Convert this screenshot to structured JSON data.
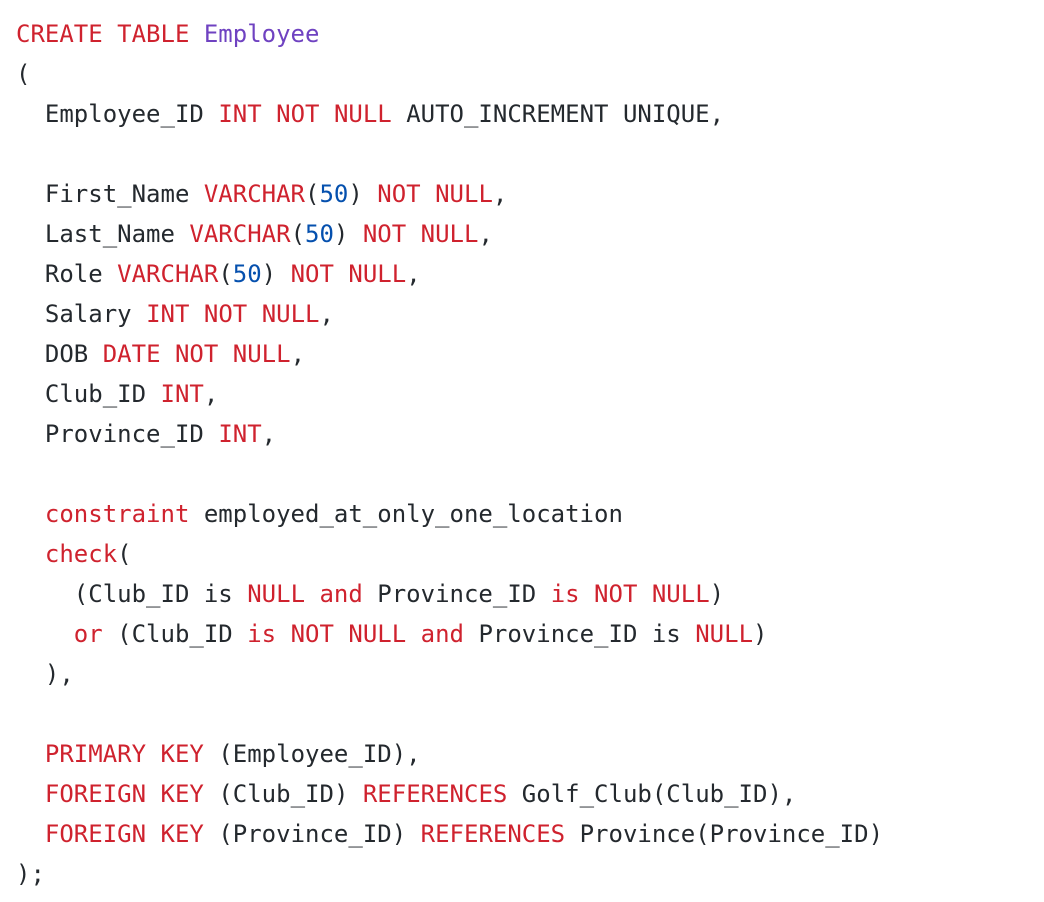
{
  "editor": {
    "language": "sql",
    "colors": {
      "background": "#ffffff",
      "keyword": "#cf222e",
      "identifier": "#24292e",
      "number": "#0550ae",
      "type_name": "#6f42c1"
    },
    "lines": [
      [
        {
          "t": "keyword",
          "v": "CREATE"
        },
        {
          "t": "space",
          "v": " "
        },
        {
          "t": "keyword",
          "v": "TABLE"
        },
        {
          "t": "space",
          "v": " "
        },
        {
          "t": "type",
          "v": "Employee"
        }
      ],
      [
        {
          "t": "punct",
          "v": "("
        }
      ],
      [
        {
          "t": "space",
          "v": "  "
        },
        {
          "t": "ident",
          "v": "Employee_ID"
        },
        {
          "t": "space",
          "v": " "
        },
        {
          "t": "keyword",
          "v": "INT"
        },
        {
          "t": "space",
          "v": " "
        },
        {
          "t": "keyword",
          "v": "NOT"
        },
        {
          "t": "space",
          "v": " "
        },
        {
          "t": "keyword",
          "v": "NULL"
        },
        {
          "t": "space",
          "v": " "
        },
        {
          "t": "ident",
          "v": "AUTO_INCREMENT"
        },
        {
          "t": "space",
          "v": " "
        },
        {
          "t": "ident",
          "v": "UNIQUE"
        },
        {
          "t": "punct",
          "v": ","
        }
      ],
      [],
      [
        {
          "t": "space",
          "v": "  "
        },
        {
          "t": "ident",
          "v": "First_Name"
        },
        {
          "t": "space",
          "v": " "
        },
        {
          "t": "keyword",
          "v": "VARCHAR"
        },
        {
          "t": "punct",
          "v": "("
        },
        {
          "t": "number",
          "v": "50"
        },
        {
          "t": "punct",
          "v": ")"
        },
        {
          "t": "space",
          "v": " "
        },
        {
          "t": "keyword",
          "v": "NOT"
        },
        {
          "t": "space",
          "v": " "
        },
        {
          "t": "keyword",
          "v": "NULL"
        },
        {
          "t": "punct",
          "v": ","
        }
      ],
      [
        {
          "t": "space",
          "v": "  "
        },
        {
          "t": "ident",
          "v": "Last_Name"
        },
        {
          "t": "space",
          "v": " "
        },
        {
          "t": "keyword",
          "v": "VARCHAR"
        },
        {
          "t": "punct",
          "v": "("
        },
        {
          "t": "number",
          "v": "50"
        },
        {
          "t": "punct",
          "v": ")"
        },
        {
          "t": "space",
          "v": " "
        },
        {
          "t": "keyword",
          "v": "NOT"
        },
        {
          "t": "space",
          "v": " "
        },
        {
          "t": "keyword",
          "v": "NULL"
        },
        {
          "t": "punct",
          "v": ","
        }
      ],
      [
        {
          "t": "space",
          "v": "  "
        },
        {
          "t": "ident",
          "v": "Role"
        },
        {
          "t": "space",
          "v": " "
        },
        {
          "t": "keyword",
          "v": "VARCHAR"
        },
        {
          "t": "punct",
          "v": "("
        },
        {
          "t": "number",
          "v": "50"
        },
        {
          "t": "punct",
          "v": ")"
        },
        {
          "t": "space",
          "v": " "
        },
        {
          "t": "keyword",
          "v": "NOT"
        },
        {
          "t": "space",
          "v": " "
        },
        {
          "t": "keyword",
          "v": "NULL"
        },
        {
          "t": "punct",
          "v": ","
        }
      ],
      [
        {
          "t": "space",
          "v": "  "
        },
        {
          "t": "ident",
          "v": "Salary"
        },
        {
          "t": "space",
          "v": " "
        },
        {
          "t": "keyword",
          "v": "INT"
        },
        {
          "t": "space",
          "v": " "
        },
        {
          "t": "keyword",
          "v": "NOT"
        },
        {
          "t": "space",
          "v": " "
        },
        {
          "t": "keyword",
          "v": "NULL"
        },
        {
          "t": "punct",
          "v": ","
        }
      ],
      [
        {
          "t": "space",
          "v": "  "
        },
        {
          "t": "ident",
          "v": "DOB"
        },
        {
          "t": "space",
          "v": " "
        },
        {
          "t": "keyword",
          "v": "DATE"
        },
        {
          "t": "space",
          "v": " "
        },
        {
          "t": "keyword",
          "v": "NOT"
        },
        {
          "t": "space",
          "v": " "
        },
        {
          "t": "keyword",
          "v": "NULL"
        },
        {
          "t": "punct",
          "v": ","
        }
      ],
      [
        {
          "t": "space",
          "v": "  "
        },
        {
          "t": "ident",
          "v": "Club_ID"
        },
        {
          "t": "space",
          "v": " "
        },
        {
          "t": "keyword",
          "v": "INT"
        },
        {
          "t": "punct",
          "v": ","
        }
      ],
      [
        {
          "t": "space",
          "v": "  "
        },
        {
          "t": "ident",
          "v": "Province_ID"
        },
        {
          "t": "space",
          "v": " "
        },
        {
          "t": "keyword",
          "v": "INT"
        },
        {
          "t": "punct",
          "v": ","
        }
      ],
      [],
      [
        {
          "t": "space",
          "v": "  "
        },
        {
          "t": "keyword",
          "v": "constraint"
        },
        {
          "t": "space",
          "v": " "
        },
        {
          "t": "ident",
          "v": "employed_at_only_one_location"
        }
      ],
      [
        {
          "t": "space",
          "v": "  "
        },
        {
          "t": "keyword",
          "v": "check"
        },
        {
          "t": "punct",
          "v": "("
        }
      ],
      [
        {
          "t": "space",
          "v": "    "
        },
        {
          "t": "punct",
          "v": "("
        },
        {
          "t": "ident",
          "v": "Club_ID"
        },
        {
          "t": "space",
          "v": " "
        },
        {
          "t": "ident",
          "v": "is"
        },
        {
          "t": "space",
          "v": " "
        },
        {
          "t": "keyword",
          "v": "NULL"
        },
        {
          "t": "space",
          "v": " "
        },
        {
          "t": "keyword",
          "v": "and"
        },
        {
          "t": "space",
          "v": " "
        },
        {
          "t": "ident",
          "v": "Province_ID"
        },
        {
          "t": "space",
          "v": " "
        },
        {
          "t": "keyword",
          "v": "is"
        },
        {
          "t": "space",
          "v": " "
        },
        {
          "t": "keyword",
          "v": "NOT"
        },
        {
          "t": "space",
          "v": " "
        },
        {
          "t": "keyword",
          "v": "NULL"
        },
        {
          "t": "punct",
          "v": ")"
        }
      ],
      [
        {
          "t": "space",
          "v": "    "
        },
        {
          "t": "keyword",
          "v": "or"
        },
        {
          "t": "space",
          "v": " "
        },
        {
          "t": "punct",
          "v": "("
        },
        {
          "t": "ident",
          "v": "Club_ID"
        },
        {
          "t": "space",
          "v": " "
        },
        {
          "t": "keyword",
          "v": "is"
        },
        {
          "t": "space",
          "v": " "
        },
        {
          "t": "keyword",
          "v": "NOT"
        },
        {
          "t": "space",
          "v": " "
        },
        {
          "t": "keyword",
          "v": "NULL"
        },
        {
          "t": "space",
          "v": " "
        },
        {
          "t": "keyword",
          "v": "and"
        },
        {
          "t": "space",
          "v": " "
        },
        {
          "t": "ident",
          "v": "Province_ID"
        },
        {
          "t": "space",
          "v": " "
        },
        {
          "t": "ident",
          "v": "is"
        },
        {
          "t": "space",
          "v": " "
        },
        {
          "t": "keyword",
          "v": "NULL"
        },
        {
          "t": "punct",
          "v": ")"
        }
      ],
      [
        {
          "t": "space",
          "v": "  "
        },
        {
          "t": "punct",
          "v": "),"
        }
      ],
      [],
      [
        {
          "t": "space",
          "v": "  "
        },
        {
          "t": "keyword",
          "v": "PRIMARY"
        },
        {
          "t": "space",
          "v": " "
        },
        {
          "t": "keyword",
          "v": "KEY"
        },
        {
          "t": "space",
          "v": " "
        },
        {
          "t": "punct",
          "v": "("
        },
        {
          "t": "ident",
          "v": "Employee_ID"
        },
        {
          "t": "punct",
          "v": "),"
        }
      ],
      [
        {
          "t": "space",
          "v": "  "
        },
        {
          "t": "keyword",
          "v": "FOREIGN"
        },
        {
          "t": "space",
          "v": " "
        },
        {
          "t": "keyword",
          "v": "KEY"
        },
        {
          "t": "space",
          "v": " "
        },
        {
          "t": "punct",
          "v": "("
        },
        {
          "t": "ident",
          "v": "Club_ID"
        },
        {
          "t": "punct",
          "v": ")"
        },
        {
          "t": "space",
          "v": " "
        },
        {
          "t": "keyword",
          "v": "REFERENCES"
        },
        {
          "t": "space",
          "v": " "
        },
        {
          "t": "ident",
          "v": "Golf_Club"
        },
        {
          "t": "punct",
          "v": "("
        },
        {
          "t": "ident",
          "v": "Club_ID"
        },
        {
          "t": "punct",
          "v": "),"
        }
      ],
      [
        {
          "t": "space",
          "v": "  "
        },
        {
          "t": "keyword",
          "v": "FOREIGN"
        },
        {
          "t": "space",
          "v": " "
        },
        {
          "t": "keyword",
          "v": "KEY"
        },
        {
          "t": "space",
          "v": " "
        },
        {
          "t": "punct",
          "v": "("
        },
        {
          "t": "ident",
          "v": "Province_ID"
        },
        {
          "t": "punct",
          "v": ")"
        },
        {
          "t": "space",
          "v": " "
        },
        {
          "t": "keyword",
          "v": "REFERENCES"
        },
        {
          "t": "space",
          "v": " "
        },
        {
          "t": "ident",
          "v": "Province"
        },
        {
          "t": "punct",
          "v": "("
        },
        {
          "t": "ident",
          "v": "Province_ID"
        },
        {
          "t": "punct",
          "v": ")"
        }
      ],
      [
        {
          "t": "punct",
          "v": ");"
        }
      ]
    ]
  }
}
